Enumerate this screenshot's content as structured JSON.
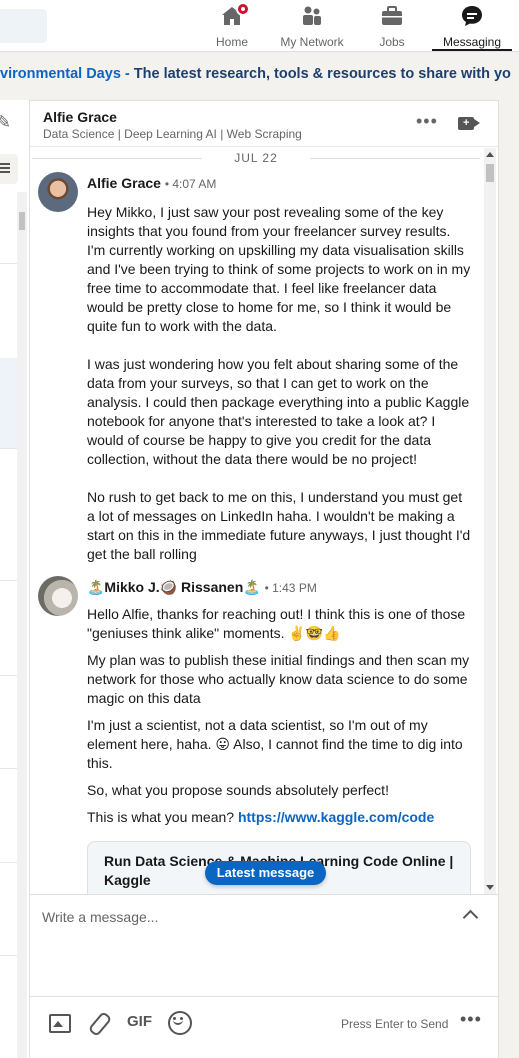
{
  "nav": {
    "items": [
      {
        "label": "Home",
        "icon": "home-icon"
      },
      {
        "label": "My Network",
        "icon": "network-icon"
      },
      {
        "label": "Jobs",
        "icon": "briefcase-icon"
      },
      {
        "label": "Messaging",
        "icon": "messaging-icon"
      }
    ],
    "active": "Messaging",
    "badge_color": "#cb112d"
  },
  "banner": {
    "link_text": "vironmental Days -",
    "text": " The latest research, tools & resources to share with yo"
  },
  "conversation": {
    "name": "Alfie Grace",
    "headline": "Data Science | Deep Learning AI | Web Scraping",
    "date_divider": "JUL 22",
    "messages": [
      {
        "sender": "Alfie Grace",
        "time": "4:07 AM",
        "paragraphs": [
          "Hey Mikko, I just saw your post revealing some of the key insights that you found from your freelancer survey results. I'm currently working on upskilling my data visualisation skills and I've been trying to think of some projects to work on in my free time to accommodate that. I feel like freelancer data would be pretty close to home for me, so I think it would be quite fun to work with the data.",
          "I was just wondering how you felt about sharing some of the data from your surveys, so that I can get to work on the analysis. I could then package everything into a public Kaggle notebook for anyone that's interested to take a look at? I would of course be happy to give you credit for the data collection, without the data there would be no project!",
          "No rush to get back to me on this, I understand you must get a lot of messages on LinkedIn haha. I wouldn't be making a start on this in the immediate future anyways, I just thought I'd get the ball rolling"
        ]
      },
      {
        "sender": "🏝️Mikko J.🥥 Rissanen🏝️",
        "time": "1:43 PM",
        "paragraphs": [
          "Hello Alfie, thanks for reaching out! I think this is one of those \"geniuses think alike\" moments. ✌️🤓👍",
          "My plan was to publish these initial findings and then scan my network for those who actually know data science to do some magic on this data",
          "I'm just a scientist, not a data scientist, so I'm out of my element here, haha. 😛 Also, I cannot find the time to dig into this.",
          "So, what you propose sounds absolutely perfect!",
          "This is what you mean? "
        ],
        "link": "https://www.kaggle.com/code"
      }
    ],
    "preview_title": "Run Data Science & Machine Learning Code Online | Kaggle",
    "latest_message_label": "Latest message"
  },
  "composer": {
    "placeholder": "Write a message...",
    "gif_label": "GIF",
    "send_hint": "Press Enter to Send",
    "more": "•••",
    "header_more": "•••"
  },
  "colors": {
    "accent": "#0a66c2",
    "background": "#f3f2ef"
  }
}
